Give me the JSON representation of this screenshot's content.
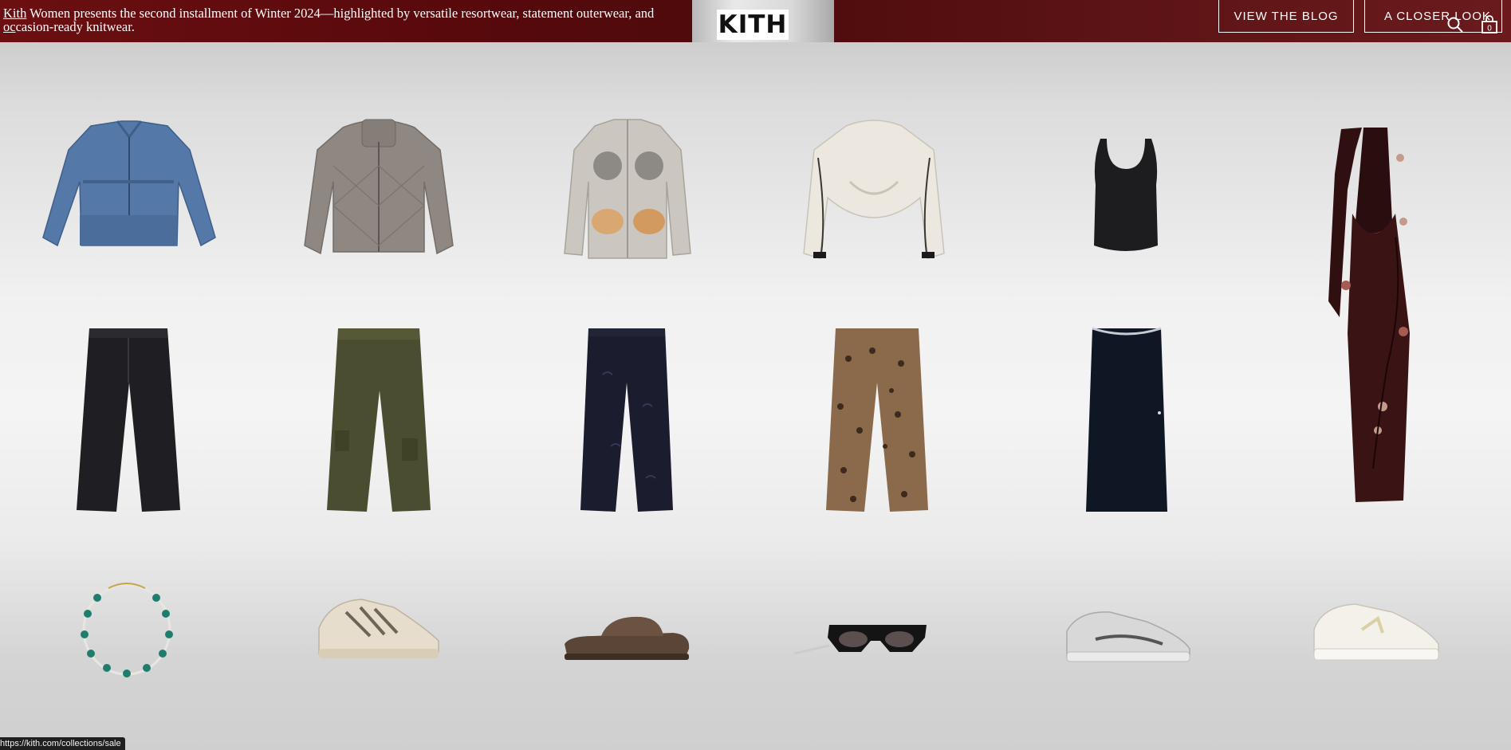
{
  "banner": {
    "text_kith": "Kith",
    "text_line1_rest": " Women presents the second installment of Winter 2024—highlighted by versatile resortwear, statement outerwear, and",
    "text_line2_oc": "oc",
    "text_line2_rest": "casion-ready knitwear.",
    "logo": "KITH",
    "view_blog_label": "VIEW THE BLOG",
    "closer_look_label": "A CLOSER LOOK"
  },
  "header_icons": {
    "search": "search-icon",
    "bag": "shopping-bag-icon",
    "bag_count": "0"
  },
  "products": [
    {
      "name": "denim-jacket",
      "color": "#5479a8"
    },
    {
      "name": "quilted-puffer-jacket",
      "color": "#8f8781"
    },
    {
      "name": "printed-shirt",
      "color": "#cbc7c0"
    },
    {
      "name": "sherpa-jacket",
      "color": "#ece8e0"
    },
    {
      "name": "black-tank-top",
      "color": "#1d1d1f"
    },
    {
      "name": "halter-maxi-dress",
      "color": "#3a1414"
    },
    {
      "name": "black-trousers",
      "color": "#1f1f23"
    },
    {
      "name": "olive-cargo-pants",
      "color": "#4b4d30"
    },
    {
      "name": "navy-jeans",
      "color": "#1b1d2e"
    },
    {
      "name": "leopard-cargo-pants",
      "color": "#8a6a4a"
    },
    {
      "name": "navy-maxi-skirt",
      "color": "#0f1624"
    },
    {
      "name": "beaded-necklace",
      "color": "#1f7d6e"
    },
    {
      "name": "cream-trail-sneakers",
      "color": "#e6ddcc"
    },
    {
      "name": "brown-suede-slides",
      "color": "#5a4536"
    },
    {
      "name": "black-sunglasses",
      "color": "#141414"
    },
    {
      "name": "silver-running-sneakers",
      "color": "#d8d8d8"
    },
    {
      "name": "white-cream-sneakers",
      "color": "#f3f1ea"
    }
  ],
  "status_bar": {
    "url": "https://kith.com/collections/sale"
  }
}
